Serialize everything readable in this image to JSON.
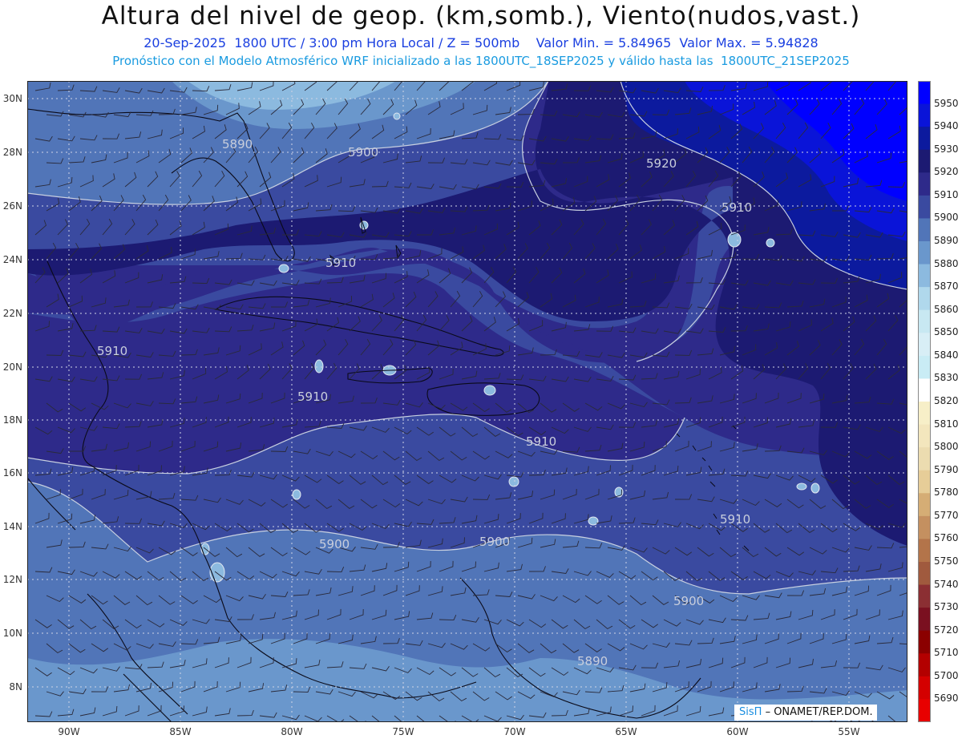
{
  "header": {
    "title": "Altura del nivel de geop. (km,somb.), Viento(nudos,vast.)",
    "line1": "20-Sep-2025  1800 UTC / 3:00 pm Hora Local / Z = 500mb    Valor Min. = 5.84965  Valor Max. = 5.94828",
    "line2": "Pronóstico con el Modelo Atmosférico WRF inicializado a las 1800UTC_18SEP2025 y válido hasta las  1800UTC_21SEP2025"
  },
  "map": {
    "lat_labels": [
      "30N",
      "28N",
      "26N",
      "24N",
      "22N",
      "20N",
      "18N",
      "16N",
      "14N",
      "12N",
      "10N",
      "8N"
    ],
    "lon_labels": [
      "90W",
      "85W",
      "80W",
      "75W",
      "70W",
      "65W",
      "60W",
      "55W"
    ],
    "contour_labels": [
      "5890",
      "5900",
      "5920",
      "5910",
      "5910",
      "5910",
      "5910",
      "5910",
      "5910",
      "5900",
      "5900",
      "5900",
      "5890"
    ],
    "credit_brand": "SisΠ",
    "credit_text": "– ONAMET/REP.DOM."
  },
  "colorbar": {
    "levels": [
      "5950",
      "5940",
      "5930",
      "5920",
      "5910",
      "5900",
      "5890",
      "5880",
      "5870",
      "5860",
      "5850",
      "5840",
      "5830",
      "5820",
      "5810",
      "5800",
      "5790",
      "5780",
      "5770",
      "5760",
      "5750",
      "5740",
      "5730",
      "5720",
      "5710",
      "5700",
      "5690"
    ],
    "colors": [
      "#0000ff",
      "#0a14d8",
      "#0c1a9e",
      "#1c1a72",
      "#2e2a8a",
      "#3a4aa0",
      "#5175b8",
      "#6a97cc",
      "#8cbadf",
      "#b0d8ec",
      "#c8e8f2",
      "#d8eef6",
      "#c9ecf5",
      "#ffffff",
      "#f7efc8",
      "#f3e6bd",
      "#ecdcb0",
      "#e6cd98",
      "#d5ad75",
      "#c49060",
      "#b3744a",
      "#a05a3e",
      "#8b2f33",
      "#7a1020",
      "#8b0000",
      "#b30000",
      "#d40000",
      "#e80000"
    ],
    "top_color": "#0000ff"
  }
}
